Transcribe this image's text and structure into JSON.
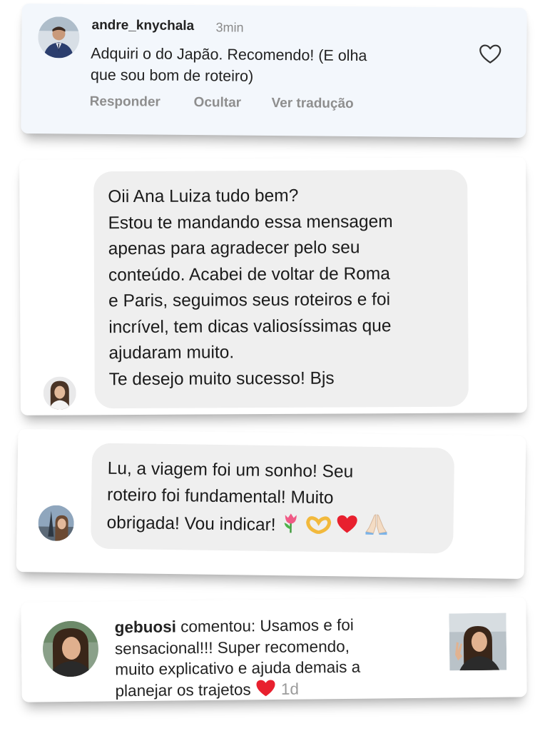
{
  "comment_1": {
    "username": "andre_knychala",
    "time": "3min",
    "text_line_1": "Adquiri o do Japão. Recomendo! (E olha",
    "text_line_2": "que sou bom de roteiro)",
    "actions": {
      "reply": "Responder",
      "hide": "Ocultar",
      "translate": "Ver tradução"
    },
    "like_icon": "heart-outline-icon"
  },
  "message_1": {
    "lines": [
      "Oii Ana Luiza tudo bem?",
      "Estou te mandando essa mensagem",
      "apenas para agradecer pelo seu",
      "conteúdo. Acabei de voltar de Roma",
      "e Paris, seguimos seus roteiros e foi",
      "incrível, tem dicas valiosíssimas que",
      "ajudaram muito.",
      "Te desejo muito sucesso! Bjs"
    ]
  },
  "message_2": {
    "lines": [
      "Lu, a viagem foi um sonho! Seu",
      "roteiro foi fundamental! Muito",
      "obrigada! Vou indicar!"
    ],
    "emojis": [
      "tulip-icon",
      "heart-hands-icon",
      "red-heart-icon",
      "praying-hands-icon"
    ]
  },
  "comment_2": {
    "username": "gebuosi",
    "line_1_rest": " comentou: Usamos e foi",
    "line_2": "sensacional!!! Super recomendo,",
    "line_3": "muito explicativo e ajuda demais a",
    "line_4": "planejar os trajetos",
    "time": "1d",
    "emoji": "red-heart-icon"
  },
  "colors": {
    "bubble": "#efefef",
    "card_1_background": "#f3f7fc",
    "action_gray": "#8e8e8e",
    "heart_red": "#e8202e"
  }
}
